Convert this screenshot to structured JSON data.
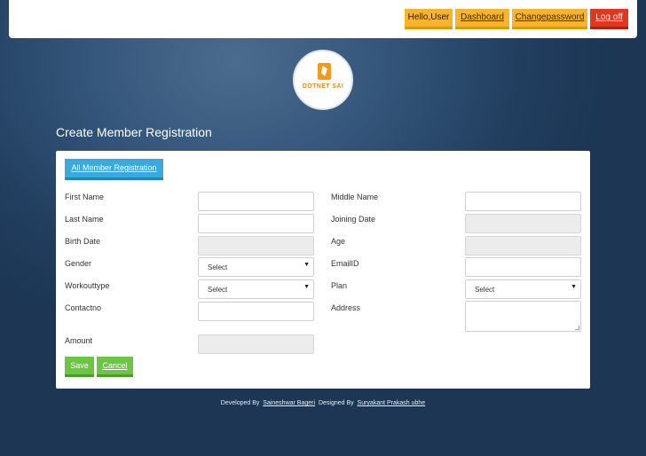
{
  "header": {
    "greeting": "Hello,User",
    "dashboard_label": "Dashboard",
    "change_password_label": "Changepassword",
    "logoff_label": "Log off"
  },
  "logo": {
    "text": "DOTNET SAI"
  },
  "page_title": "Create Member Registration",
  "panel": {
    "all_registration_label": "All Member Registration",
    "fields": {
      "first_name": "First Name",
      "middle_name": "Middle Name",
      "last_name": "Last Name",
      "joining_date": "Joining Date",
      "birth_date": "Birth Date",
      "age": "Age",
      "gender": "Gender",
      "email": "EmailID",
      "workout_type": "Workouttype",
      "plan": "Plan",
      "contact": "Contactno",
      "address": "Address",
      "amount": "Amount"
    },
    "selects": {
      "gender": "Select",
      "workout_type": "Select",
      "plan": "Select"
    },
    "save_label": "Save",
    "cancel_label": "Cancel"
  },
  "footer": {
    "developed_by": "Developed By",
    "developer": "Saineshwar Bageri",
    "designed_by": "Designed By",
    "designer": "Suryakant Prakash ubhe"
  },
  "colors": {
    "nav_orange": "#f7b42c",
    "logoff_red": "#e2371c",
    "primary_blue": "#3aa9dd",
    "action_green": "#6cc644"
  }
}
